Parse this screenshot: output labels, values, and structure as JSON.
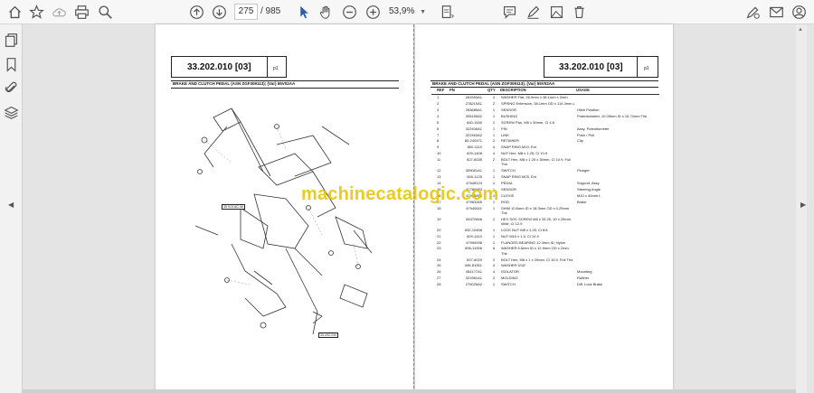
{
  "toolbar": {
    "current_page": "275",
    "total_pages": "/ 985",
    "zoom": "53,9%",
    "icons": [
      "home-icon",
      "bookmark-star-icon",
      "upload-icon",
      "print-icon",
      "zoom-search-icon",
      "page-up-icon",
      "page-down-icon",
      "select-cursor-icon",
      "hand-pan-icon",
      "zoom-out-icon",
      "zoom-in-icon",
      "fit-page-icon",
      "comment-icon",
      "highlight-pen-icon",
      "delete-icon",
      "pen-sign-icon",
      "email-icon",
      "account-icon"
    ]
  },
  "left_page": {
    "doc_number": "33.202.010 [03]",
    "page_tag": "p1",
    "title": "BRAKE AND CLUTCH PEDAL (ASN ZGF309113); (Var) 55V02AA",
    "callout_top": "35.913.AC.06",
    "callout_bottom": "33.202.CM"
  },
  "right_page": {
    "doc_number": "33.202.010 [03]",
    "page_tag": "p1",
    "title": "BRAKE AND CLUTCH PEDAL (ASN ZGF309113); (Var) 55V02AA",
    "columns": [
      "REF",
      "PN",
      "QTY",
      "DESCRIPTION",
      "USAGE"
    ],
    "rows": [
      [
        "1",
        "281593A1",
        "4",
        "WASHER Flat, 26.9mm x 38.1mm x 2mm",
        ""
      ],
      [
        "2",
        "278210A1",
        "2",
        "SPRING Extension, 38.1mm OD x 114.3mm L",
        ""
      ],
      [
        "3",
        "283685A1",
        "1",
        "SENSOR",
        "Hitch Position"
      ],
      [
        "4",
        "305155A2",
        "1",
        "BUSHING",
        "Potentiometer, 10.05mm ID x 15.72mm Thk"
      ],
      [
        "5",
        "840-1530",
        "2",
        "SCREW Pan, M5 x 30mm, Cl 4.8",
        ""
      ],
      [
        "6",
        "322406A1",
        "1",
        "PIN",
        "Assy, Potentiometer"
      ],
      [
        "7",
        "322463A2",
        "1",
        "LINK",
        "Push / Pull"
      ],
      [
        "8",
        "80-240471",
        "2",
        "RETAINER",
        "Clip"
      ],
      [
        "9",
        "800-1110",
        "4",
        "SNAP RING M10, Ext",
        ""
      ],
      [
        "10",
        "829-1408",
        "4",
        "NUT Hex, M8 x 1.25, Cl 10.9",
        ""
      ],
      [
        "11",
        "827-8035",
        "2",
        "BOLT Hex, M8 x 1.25 x 35mm, Cl 10.9, Full Thd",
        ""
      ],
      [
        "12",
        "305061A1",
        "1",
        "SWITCH",
        "Plunger"
      ],
      [
        "13",
        "800-1125",
        "1",
        "SNAP RING M25, Ext",
        ""
      ],
      [
        "14",
        "47648123",
        "1",
        "PEDAL",
        "Support, Assy"
      ],
      [
        "15",
        "47786983",
        "1",
        "SENSOR",
        "Steering Angle"
      ],
      [
        "16",
        "47948893",
        "1",
        "CLEVIS",
        "M10 x 40mm L"
      ],
      [
        "17",
        "47963265",
        "1",
        "ROD",
        "Brake"
      ],
      [
        "18",
        "47940641",
        "1",
        "SHIM 10.6mm ID x 18.3mm OD x 0.25mm Thk",
        ""
      ],
      [
        "19",
        "84370846",
        "1",
        "HEX SOC SCREW M8 x 33.25, 10 x 20mm shldr, Cl 12.9",
        ""
      ],
      [
        "20",
        "832-10408",
        "1",
        "LOCK NUT M8 x 1.25, Cl 8.8",
        ""
      ],
      [
        "21",
        "829-1410",
        "1",
        "NUT M10 x 1.5, Cl 10.9",
        ""
      ],
      [
        "22",
        "47906938",
        "1",
        "FLANGED BEARING 12.3mm ID, Nylon",
        ""
      ],
      [
        "23",
        "896-11006",
        "6",
        "WASHER 6.6mm ID x 12.9mm OD x 2mm Thk",
        ""
      ],
      [
        "24",
        "827-6020",
        "2",
        "BOLT Hex, M6 x 1 x 20mm, Cl 10.9, Full Thd",
        ""
      ],
      [
        "26",
        "495-81001",
        "4",
        "WASHER 5/16\"",
        ""
      ],
      [
        "26",
        "454177A1",
        "4",
        "ISOLATOR",
        "Mounting"
      ],
      [
        "27",
        "321981A1",
        "2",
        "MOLDING",
        "Rubber"
      ],
      [
        "28",
        "275026A2",
        "1",
        "SWITCH",
        "Diff. Lock Brake"
      ]
    ]
  },
  "watermark": "machinecatalogic.com"
}
